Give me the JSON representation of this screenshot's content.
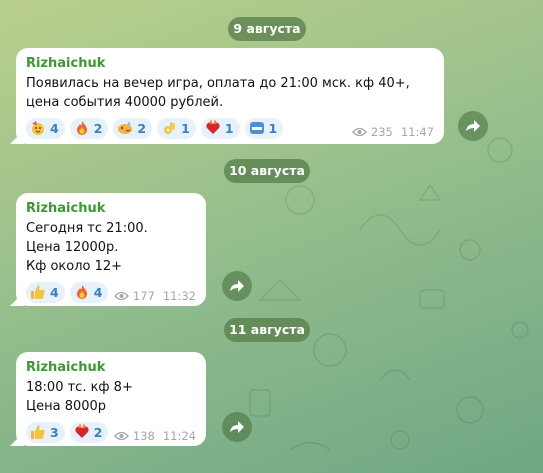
{
  "messages": [
    {
      "date": "9 августа",
      "author": "Rizhaichuk",
      "text": "Появилась на вечер игра, оплата до 21:00 мск. кф 40+, цена события 40000 рублей.",
      "reactions": [
        {
          "icon": "party-face-icon",
          "count": "4"
        },
        {
          "icon": "fire-icon",
          "count": "2"
        },
        {
          "icon": "sweat-smile-icon",
          "count": "2"
        },
        {
          "icon": "ok-hand-icon",
          "count": "1"
        },
        {
          "icon": "heart-on-fire-icon",
          "count": "1"
        },
        {
          "icon": "cool-icon",
          "count": "1"
        }
      ],
      "views": "235",
      "time": "11:47"
    },
    {
      "date": "10 августа",
      "author": "Rizhaichuk",
      "text": "Сегодня тс 21:00.\nЦена 12000р.\nКф около 12+",
      "reactions": [
        {
          "icon": "thumbs-up-icon",
          "count": "4"
        },
        {
          "icon": "fire-icon",
          "count": "4"
        }
      ],
      "views": "177",
      "time": "11:32"
    },
    {
      "date": "11 августа",
      "author": "Rizhaichuk",
      "text": "18:00 тс. кф 8+\nЦена 8000р",
      "reactions": [
        {
          "icon": "thumbs-up-icon",
          "count": "3"
        },
        {
          "icon": "heart-on-fire-icon",
          "count": "2"
        }
      ],
      "views": "138",
      "time": "11:24"
    }
  ]
}
